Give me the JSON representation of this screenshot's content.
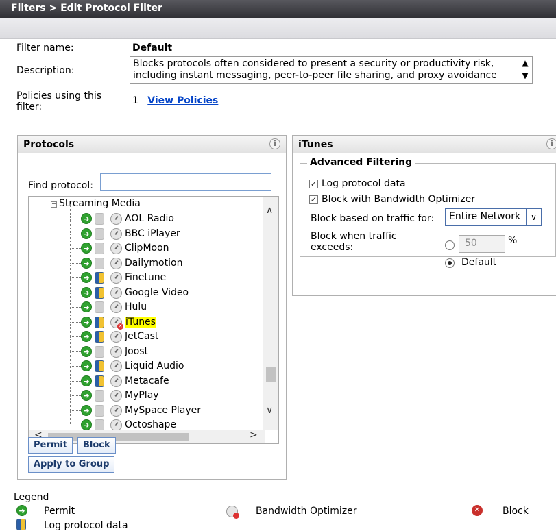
{
  "breadcrumb": {
    "root": "Filters",
    "separator": ">",
    "current": "Edit Protocol Filter"
  },
  "filter": {
    "name_label": "Filter name:",
    "name_value": "Default",
    "description_label": "Description:",
    "description_lines": [
      "Blocks protocols often considered to present a security or productivity risk,",
      "including instant messaging, peer-to-peer file sharing, and proxy avoidance"
    ],
    "policies_label_line1": "Policies using this",
    "policies_label_line2": "filter:",
    "policies_count": "1",
    "view_policies_link": "View Policies"
  },
  "protocols_panel": {
    "title": "Protocols",
    "find_label": "Find protocol:",
    "find_value": "",
    "group_label": "Streaming Media",
    "items": [
      {
        "label": "AOL Radio",
        "log": false,
        "blocked": false,
        "selected": false
      },
      {
        "label": "BBC iPlayer",
        "log": false,
        "blocked": false,
        "selected": false
      },
      {
        "label": "ClipMoon",
        "log": false,
        "blocked": false,
        "selected": false
      },
      {
        "label": "Dailymotion",
        "log": false,
        "blocked": false,
        "selected": false
      },
      {
        "label": "Finetune",
        "log": true,
        "blocked": false,
        "selected": false
      },
      {
        "label": "Google Video",
        "log": true,
        "blocked": false,
        "selected": false
      },
      {
        "label": "Hulu",
        "log": false,
        "blocked": false,
        "selected": false
      },
      {
        "label": "iTunes",
        "log": true,
        "blocked": true,
        "selected": true
      },
      {
        "label": "JetCast",
        "log": true,
        "blocked": false,
        "selected": false
      },
      {
        "label": "Joost",
        "log": false,
        "blocked": false,
        "selected": false
      },
      {
        "label": "Liquid Audio",
        "log": true,
        "blocked": false,
        "selected": false
      },
      {
        "label": "Metacafe",
        "log": true,
        "blocked": false,
        "selected": false
      },
      {
        "label": "MyPlay",
        "log": false,
        "blocked": false,
        "selected": false
      },
      {
        "label": "MySpace Player",
        "log": false,
        "blocked": false,
        "selected": false
      },
      {
        "label": "Octoshape",
        "log": false,
        "blocked": false,
        "selected": false
      }
    ],
    "permit_button": "Permit",
    "block_button": "Block",
    "apply_group_button": "Apply to Group"
  },
  "detail_panel": {
    "title": "iTunes",
    "section_title": "Advanced Filtering",
    "log_label": "Log protocol data",
    "log_checked": true,
    "bandwidth_label": "Block with Bandwidth Optimizer",
    "bandwidth_checked": true,
    "traffic_for_label": "Block based on traffic for:",
    "traffic_for_value": "Entire Network",
    "exceeds_label_line1": "Block when traffic",
    "exceeds_label_line2": "exceeds:",
    "percent_value": "50",
    "percent_unit": "%",
    "default_label": "Default",
    "default_selected": true
  },
  "legend": {
    "title": "Legend",
    "permit": "Permit",
    "bandwidth": "Bandwidth Optimizer",
    "block": "Block",
    "log": "Log protocol data"
  },
  "colors": {
    "accent_link": "#0645c8",
    "permit_green": "#2fa12f",
    "block_red": "#c9302c",
    "selection_yellow": "#ffff00"
  }
}
